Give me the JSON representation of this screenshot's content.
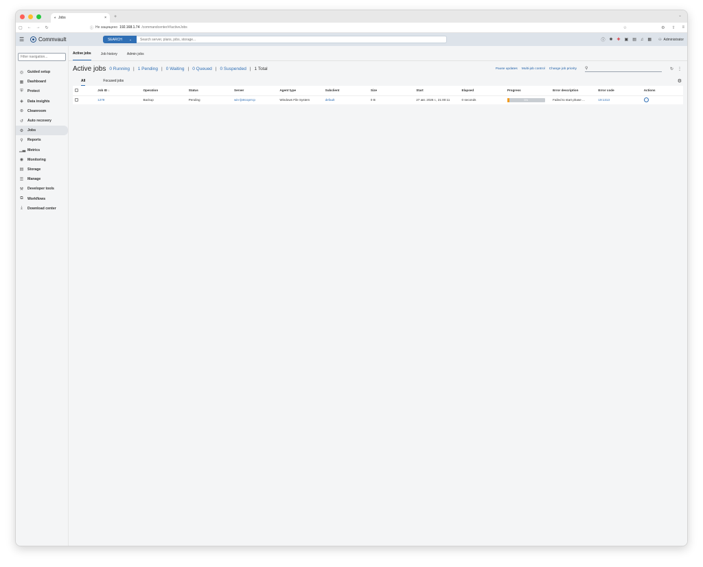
{
  "browser": {
    "tab_title": "Jobs",
    "url_secure_label": "Не защищено",
    "url_host": "192.168.1.74",
    "url_path": "/commandcenter/#/activeJobs",
    "traffic_colors": [
      "#fe5f57",
      "#febc2e",
      "#28c840"
    ]
  },
  "header": {
    "brand": "Commvault",
    "search_button": "SEARCH",
    "search_placeholder": "Search server, plans, jobs, storage...",
    "user_label": "Administrator",
    "accent_color": "#2f6fb5"
  },
  "sidebar": {
    "filter_placeholder": "Filter navigation...",
    "items": [
      {
        "label": "Guided setup",
        "icon": "guide-icon"
      },
      {
        "label": "Dashboard",
        "icon": "dashboard-icon"
      },
      {
        "label": "Protect",
        "icon": "shield-icon"
      },
      {
        "label": "Data insights",
        "icon": "insights-icon"
      },
      {
        "label": "Cleanroom",
        "icon": "cleanroom-icon"
      },
      {
        "label": "Auto recovery",
        "icon": "recovery-icon"
      },
      {
        "label": "Jobs",
        "icon": "jobs-icon",
        "active": true
      },
      {
        "label": "Reports",
        "icon": "reports-icon"
      },
      {
        "label": "Metrics",
        "icon": "metrics-icon"
      },
      {
        "label": "Monitoring",
        "icon": "monitoring-icon"
      },
      {
        "label": "Storage",
        "icon": "storage-icon"
      },
      {
        "label": "Manage",
        "icon": "manage-icon"
      },
      {
        "label": "Developer tools",
        "icon": "developer-icon"
      },
      {
        "label": "Workflows",
        "icon": "workflows-icon"
      },
      {
        "label": "Download center",
        "icon": "download-icon"
      }
    ]
  },
  "subtabs": [
    "Active jobs",
    "Job history",
    "Admin jobs"
  ],
  "page": {
    "title": "Active jobs",
    "running": "0 Running",
    "pending": "1 Pending",
    "waiting": "0 Waiting",
    "queued": "0 Queued",
    "suspended": "0 Suspended",
    "total": "1 Total",
    "pause_updates": "Pause updates",
    "multi_job_control": "Multi-job control",
    "change_job_priority": "Change job priority"
  },
  "view_tabs": [
    "All",
    "Focused jobs"
  ],
  "table": {
    "columns": [
      "Job ID",
      "Operation",
      "Status",
      "Server",
      "Agent type",
      "Subclient",
      "Size",
      "Start",
      "Elapsed",
      "Progress",
      "Error description",
      "Error code",
      "Actions"
    ],
    "rows": [
      {
        "job_id": "1279",
        "operation": "Backup",
        "status": "Pending",
        "server": "win-ljn8coprrcp",
        "agent_type": "Windows File System",
        "subclient": "default",
        "size": "0 B",
        "start": "27 авг. 2026 г., 21:00:11",
        "elapsed": "0 seconds",
        "progress_label": "5%",
        "progress_value": 0.05,
        "error_description": "Failed to start phase ...",
        "error_code": "19:1313"
      }
    ]
  }
}
